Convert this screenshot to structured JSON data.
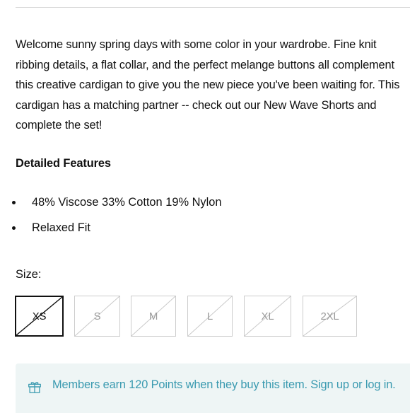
{
  "description": "Welcome sunny spring days with some color in your wardrobe. Fine knit ribbing details, a flat collar, and the perfect melange buttons all complement this creative cardigan to give you the new piece you've been waiting for. This cardigan has a matching partner -- check out our New Wave Shorts and complete the set!",
  "features": {
    "heading": "Detailed Features",
    "items": [
      "48% Viscose 33% Cotton 19% Nylon",
      "Relaxed Fit"
    ]
  },
  "size": {
    "label": "Size:",
    "options": [
      "XS",
      "S",
      "M",
      "L",
      "XL",
      "2XL"
    ],
    "selected": "XS"
  },
  "promo": {
    "icon": "gift-icon",
    "text": "Members earn 120 Points when they buy this item. Sign up or log in.",
    "color": "#3a9ab0",
    "background": "#eef5f5"
  }
}
